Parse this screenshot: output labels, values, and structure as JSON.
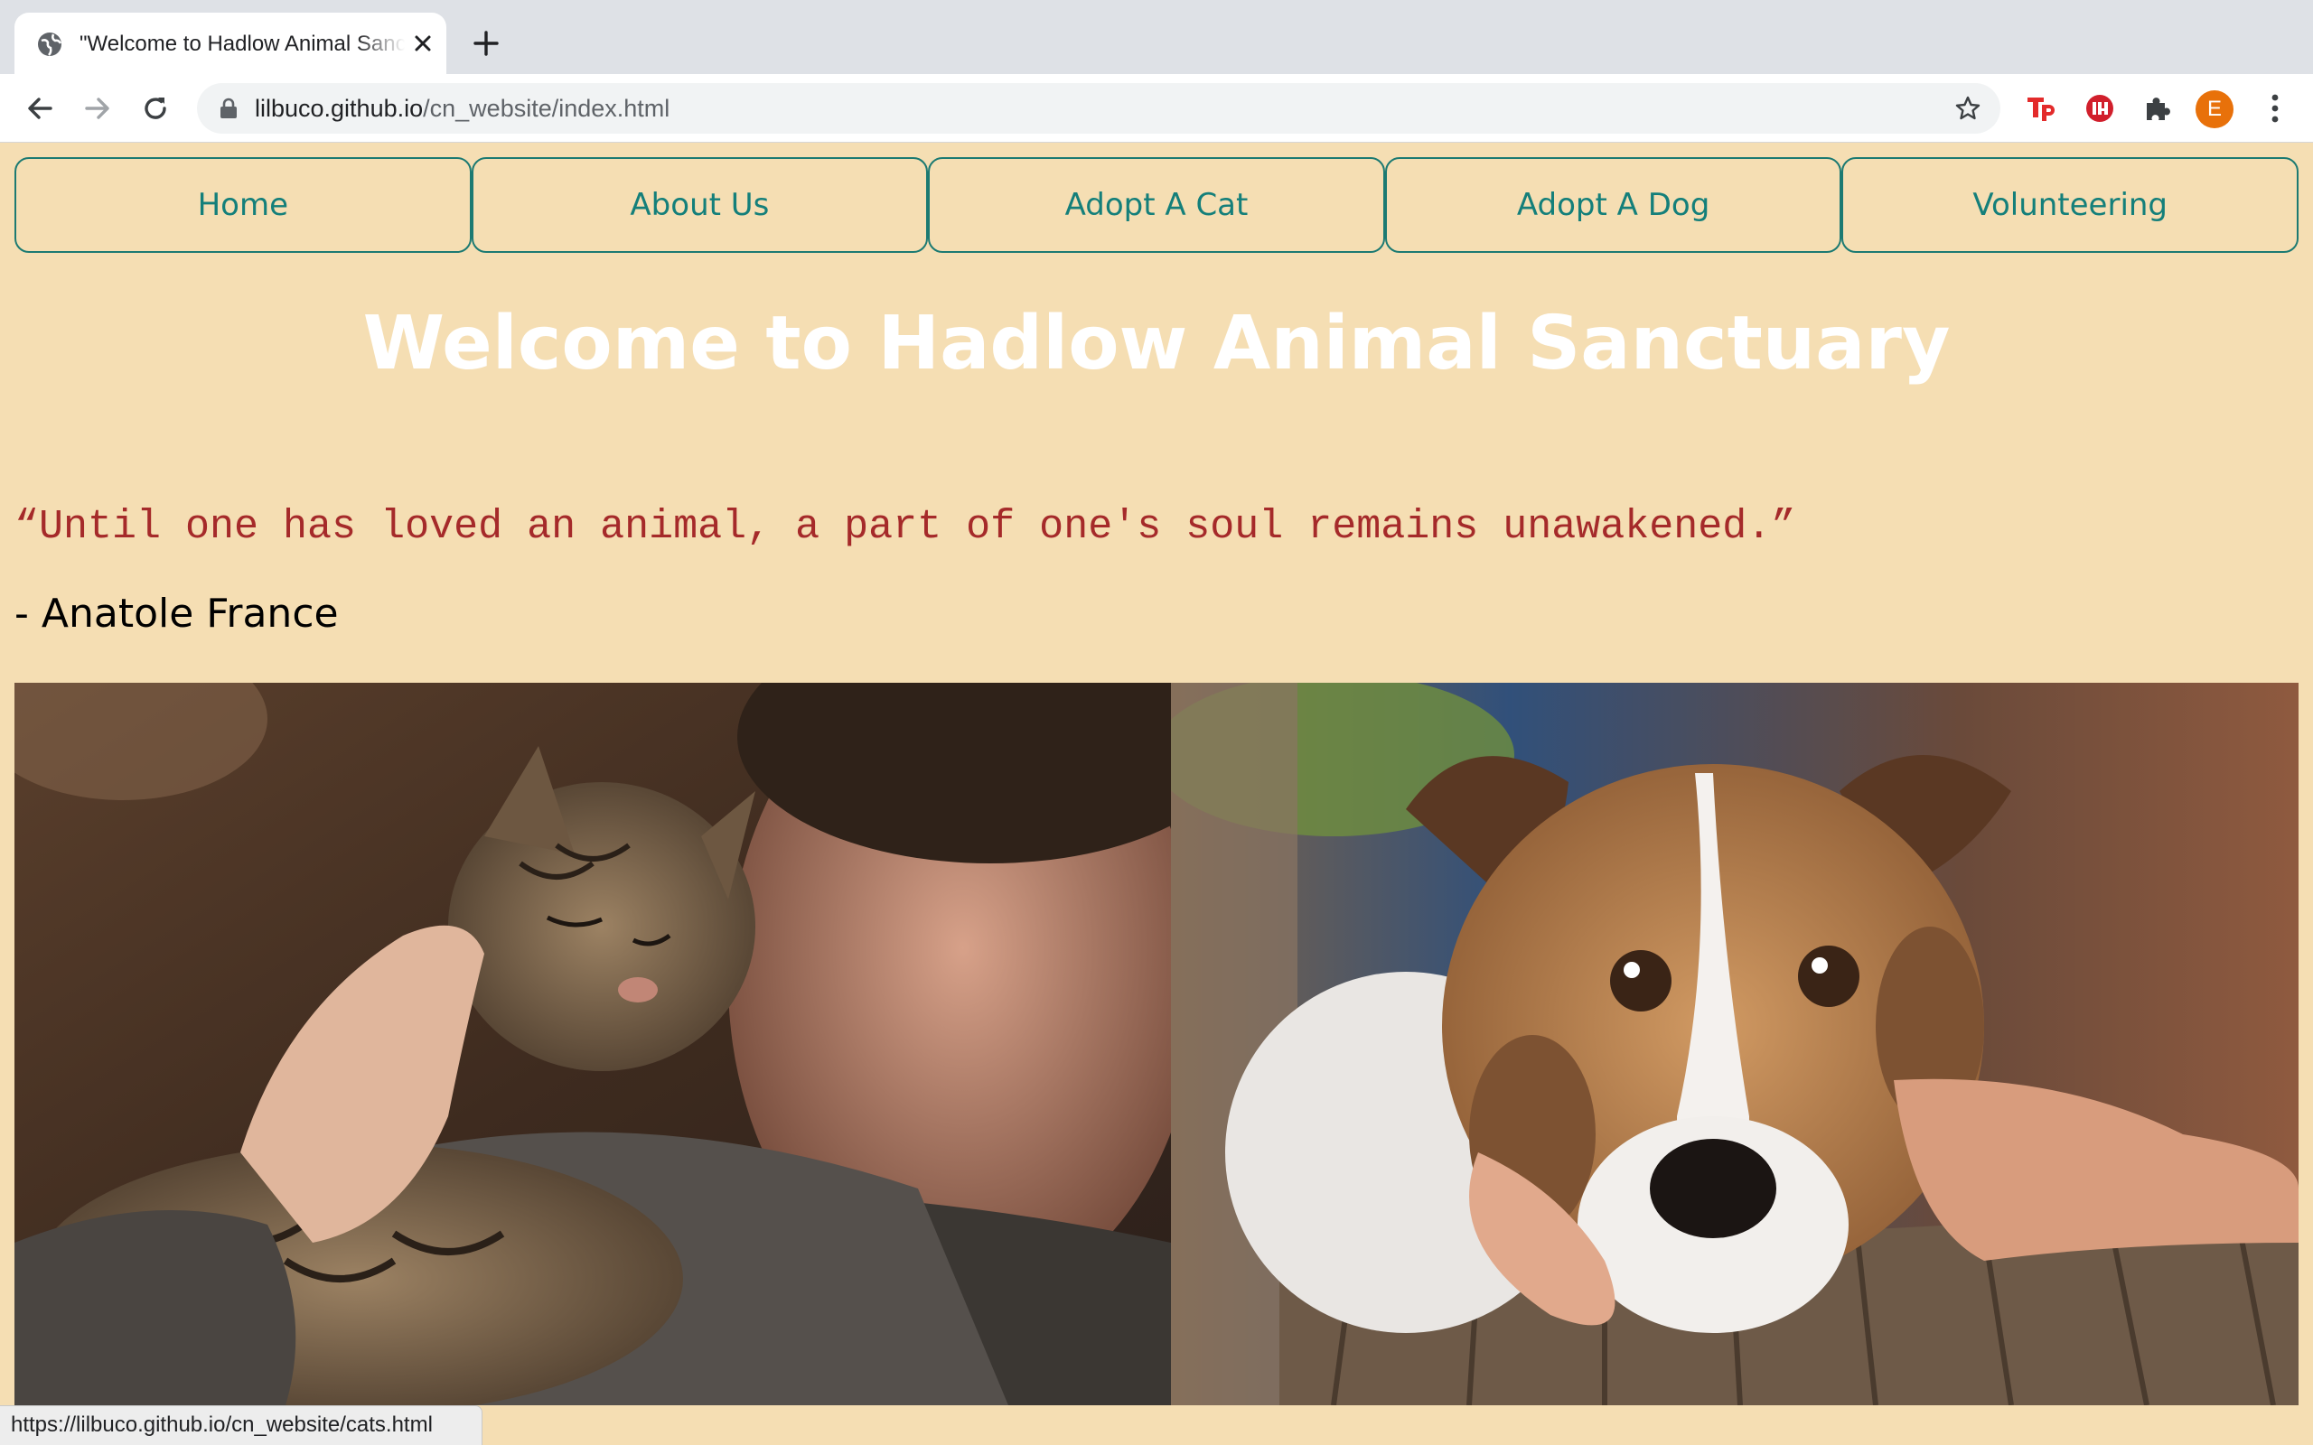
{
  "browser": {
    "tab": {
      "title": "\"Welcome to Hadlow Animal Sanctuary\"",
      "favicon": "globe-icon"
    },
    "url": {
      "host": "lilbuco.github.io",
      "path": "/cn_website/index.html"
    },
    "profile_initial": "E",
    "status_url": "https://lilbuco.github.io/cn_website/cats.html"
  },
  "nav": {
    "items": [
      {
        "label": "Home"
      },
      {
        "label": "About Us"
      },
      {
        "label": "Adopt A Cat"
      },
      {
        "label": "Adopt A Dog"
      },
      {
        "label": "Volunteering"
      }
    ]
  },
  "hero": {
    "title": "Welcome to Hadlow Animal Sanctuary"
  },
  "quote": {
    "text": "“Until one has loved an animal, a part of one's soul remains unawakened.”",
    "author": "- Anatole France"
  },
  "images": [
    {
      "name": "cat-photo",
      "description": "cat-being-petted"
    },
    {
      "name": "dog-photo",
      "description": "dog-resting-head-in-hands"
    }
  ],
  "colors": {
    "page_bg": "#f5deb3",
    "nav_text": "#147f7a",
    "nav_border": "#1c7a72",
    "title": "#ffffff",
    "quote": "#a52a2a",
    "profile": "#e8710a"
  }
}
